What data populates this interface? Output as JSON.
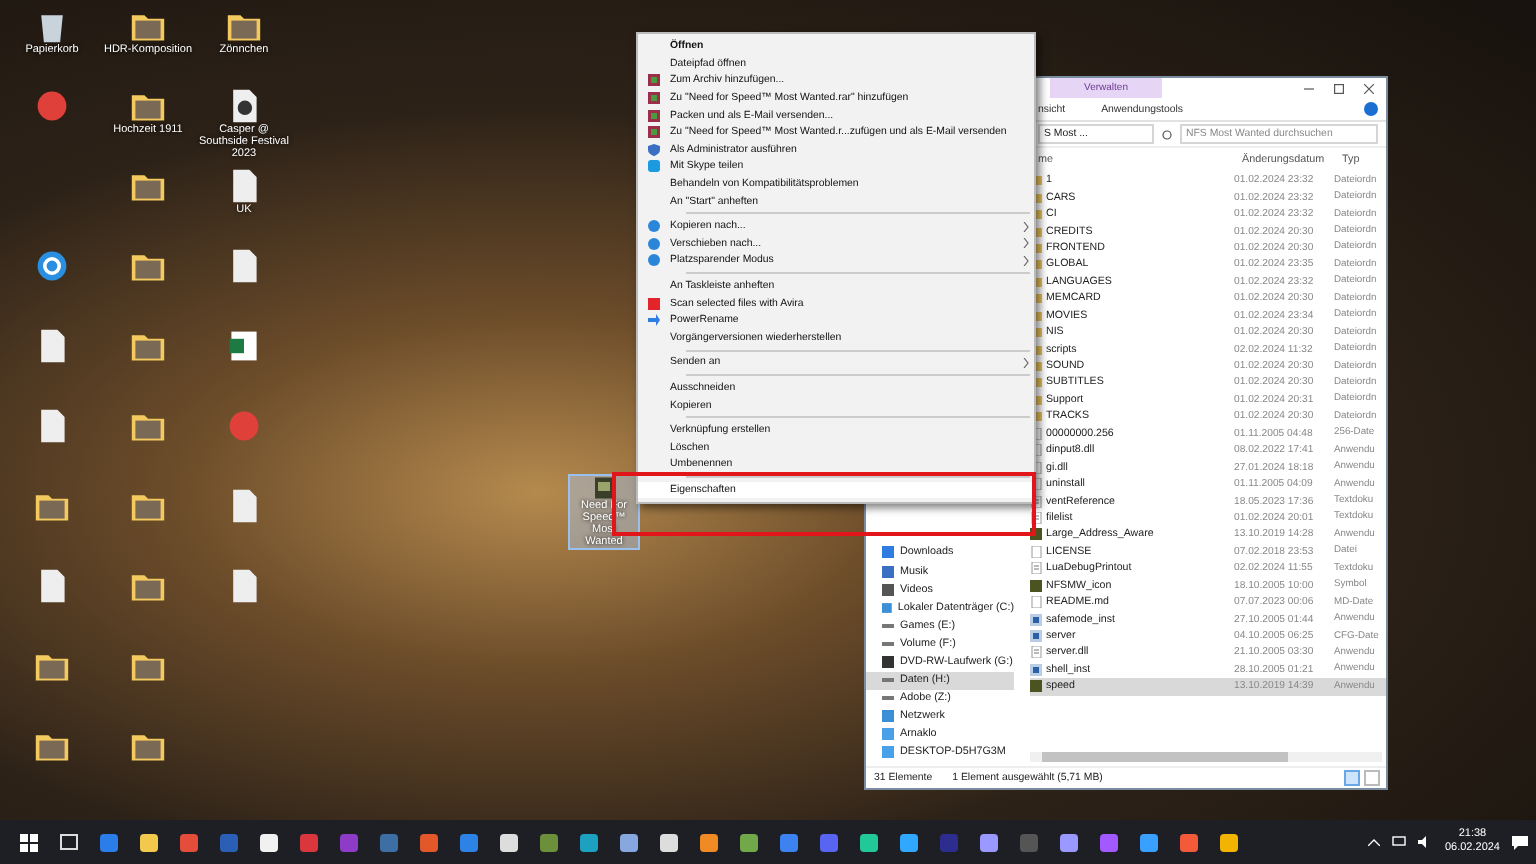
{
  "desktop": {
    "columns": [
      [
        {
          "kind": "recycle",
          "label": "Papierkorb"
        },
        {
          "kind": "app"
        },
        {
          "kind": "gap"
        },
        {
          "kind": "sync"
        },
        {
          "kind": "file"
        },
        {
          "kind": "file"
        },
        {
          "kind": "folder"
        },
        {
          "kind": "file"
        },
        {
          "kind": "folder"
        },
        {
          "kind": "folder"
        }
      ],
      [
        {
          "kind": "folder",
          "label": "HDR-Komposition"
        },
        {
          "kind": "folder",
          "label": "Hochzeit 1911"
        },
        {
          "kind": "folder"
        },
        {
          "kind": "folder"
        },
        {
          "kind": "folder"
        },
        {
          "kind": "folder"
        },
        {
          "kind": "folder"
        },
        {
          "kind": "folder"
        },
        {
          "kind": "folder"
        },
        {
          "kind": "folder"
        }
      ],
      [
        {
          "kind": "folder",
          "label": "Zönnchen"
        },
        {
          "kind": "media",
          "label": "Casper @ Southside Festival 2023"
        },
        {
          "kind": "file",
          "label": "UK"
        },
        {
          "kind": "file"
        },
        {
          "kind": "sheet"
        },
        {
          "kind": "app"
        },
        {
          "kind": "file"
        },
        {
          "kind": "file"
        }
      ]
    ],
    "selected_icon": {
      "label": "Need For Speed™ Most Wanted",
      "selected": true
    }
  },
  "context_menu": {
    "groups": [
      [
        {
          "label": "Öffnen",
          "bold": true,
          "kind": "plain",
          "submenu": false,
          "selected": false
        },
        {
          "label": "Dateipfad öffnen",
          "bold": false,
          "kind": "plain",
          "submenu": false,
          "selected": false
        },
        {
          "label": "Zum Archiv hinzufügen...",
          "bold": false,
          "kind": "archive",
          "submenu": false,
          "selected": false
        },
        {
          "label": "Zu \"Need for Speed™ Most Wanted.rar\" hinzufügen",
          "bold": false,
          "kind": "archive",
          "submenu": false,
          "selected": false
        },
        {
          "label": "Packen und als E-Mail versenden...",
          "bold": false,
          "kind": "archive",
          "submenu": false,
          "selected": false
        },
        {
          "label": "Zu \"Need for Speed™ Most Wanted.r...zufügen und als E-Mail versenden",
          "bold": false,
          "kind": "archive",
          "submenu": false,
          "selected": false
        },
        {
          "label": "Als Administrator ausführen",
          "bold": false,
          "kind": "admin",
          "submenu": false,
          "selected": false
        },
        {
          "label": "Mit Skype teilen",
          "bold": false,
          "kind": "share",
          "submenu": false,
          "selected": false
        },
        {
          "label": "Behandeln von Kompatibilitätsproblemen",
          "bold": false,
          "kind": "plain",
          "submenu": false,
          "selected": false
        },
        {
          "label": "An \"Start\" anheften",
          "bold": false,
          "kind": "plain",
          "submenu": false,
          "selected": false
        }
      ],
      [
        {
          "label": "Kopieren nach...",
          "bold": false,
          "kind": "tool",
          "submenu": true,
          "selected": false
        },
        {
          "label": "Verschieben nach...",
          "bold": false,
          "kind": "tool",
          "submenu": true,
          "selected": false
        },
        {
          "label": "Platzsparender Modus",
          "bold": false,
          "kind": "tool",
          "submenu": true,
          "selected": false
        }
      ],
      [
        {
          "label": "An Taskleiste anheften",
          "bold": false,
          "kind": "plain",
          "submenu": false,
          "selected": false
        },
        {
          "label": "Scan selected files with Avira",
          "bold": false,
          "kind": "scan",
          "submenu": false,
          "selected": false
        },
        {
          "label": "PowerRename",
          "bold": false,
          "kind": "rename",
          "submenu": false,
          "selected": false
        },
        {
          "label": "Vorgängerversionen wiederherstellen",
          "bold": false,
          "kind": "plain",
          "submenu": false,
          "selected": false
        }
      ],
      [
        {
          "label": "Senden an",
          "bold": false,
          "kind": "plain",
          "submenu": true,
          "selected": false
        }
      ],
      [
        {
          "label": "Ausschneiden",
          "bold": false,
          "kind": "plain",
          "submenu": false,
          "selected": false
        },
        {
          "label": "Kopieren",
          "bold": false,
          "kind": "plain",
          "submenu": false,
          "selected": false
        }
      ],
      [
        {
          "label": "Verknüpfung erstellen",
          "bold": false,
          "kind": "plain",
          "submenu": false,
          "selected": false
        },
        {
          "label": "Löschen",
          "bold": false,
          "kind": "plain",
          "submenu": false,
          "selected": false
        },
        {
          "label": "Umbenennen",
          "bold": false,
          "kind": "plain",
          "submenu": false,
          "selected": false
        }
      ],
      [
        {
          "label": "Eigenschaften",
          "bold": false,
          "kind": "plain",
          "submenu": false,
          "selected": true
        }
      ]
    ]
  },
  "explorer": {
    "ribbon_context_tab": "Verwalten",
    "ribbon_tabs": [
      "nsicht",
      "Anwendungstools"
    ],
    "address": "S Most ...",
    "search": {
      "placeholder": "NFS Most Wanted durchsuchen"
    },
    "columns": [
      "me",
      "Änderungsdatum",
      "Typ"
    ],
    "files": [
      {
        "kind": "folder",
        "name": "1",
        "date": "01.02.2024 23:32",
        "type": "Dateiordn",
        "selected": false
      },
      {
        "kind": "folder",
        "name": "CARS",
        "date": "01.02.2024 23:32",
        "type": "Dateiordn",
        "selected": false
      },
      {
        "kind": "folder",
        "name": "CI",
        "date": "01.02.2024 23:32",
        "type": "Dateiordn",
        "selected": false
      },
      {
        "kind": "folder",
        "name": "CREDITS",
        "date": "01.02.2024 20:30",
        "type": "Dateiordn",
        "selected": false
      },
      {
        "kind": "folder",
        "name": "FRONTEND",
        "date": "01.02.2024 20:30",
        "type": "Dateiordn",
        "selected": false
      },
      {
        "kind": "folder",
        "name": "GLOBAL",
        "date": "01.02.2024 23:35",
        "type": "Dateiordn",
        "selected": false
      },
      {
        "kind": "folder",
        "name": "LANGUAGES",
        "date": "01.02.2024 23:32",
        "type": "Dateiordn",
        "selected": false
      },
      {
        "kind": "folder",
        "name": "MEMCARD",
        "date": "01.02.2024 20:30",
        "type": "Dateiordn",
        "selected": false
      },
      {
        "kind": "folder",
        "name": "MOVIES",
        "date": "01.02.2024 23:34",
        "type": "Dateiordn",
        "selected": false
      },
      {
        "kind": "folder",
        "name": "NIS",
        "date": "01.02.2024 20:30",
        "type": "Dateiordn",
        "selected": false
      },
      {
        "kind": "folder",
        "name": "scripts",
        "date": "02.02.2024 11:32",
        "type": "Dateiordn",
        "selected": false
      },
      {
        "kind": "folder",
        "name": "SOUND",
        "date": "01.02.2024 20:30",
        "type": "Dateiordn",
        "selected": false
      },
      {
        "kind": "folder",
        "name": "SUBTITLES",
        "date": "01.02.2024 20:30",
        "type": "Dateiordn",
        "selected": false
      },
      {
        "kind": "folder",
        "name": "Support",
        "date": "01.02.2024 20:31",
        "type": "Dateiordn",
        "selected": false
      },
      {
        "kind": "folder",
        "name": "TRACKS",
        "date": "01.02.2024 20:30",
        "type": "Dateiordn",
        "selected": false
      },
      {
        "kind": "file",
        "name": "00000000.256",
        "date": "01.11.2005 04:48",
        "type": "256-Date",
        "selected": false
      },
      {
        "kind": "file",
        "name": "dinput8.dll",
        "date": "08.02.2022 17:41",
        "type": "Anwendu",
        "selected": false
      },
      {
        "kind": "file",
        "name": "gi.dll",
        "date": "27.01.2024 18:18",
        "type": "Anwendu",
        "selected": false
      },
      {
        "kind": "file",
        "name": "uninstall",
        "date": "01.11.2005 04:09",
        "type": "Anwendu",
        "selected": false
      },
      {
        "kind": "text",
        "name": "ventReference",
        "date": "18.05.2023 17:36",
        "type": "Textdoku",
        "selected": false
      },
      {
        "kind": "text",
        "name": "filelist",
        "date": "01.02.2024 20:01",
        "type": "Textdoku",
        "selected": false
      },
      {
        "kind": "app",
        "name": "Large_Address_Aware",
        "date": "13.10.2019 14:28",
        "type": "Anwendu",
        "selected": false
      },
      {
        "kind": "file",
        "name": "LICENSE",
        "date": "07.02.2018 23:53",
        "type": "Datei",
        "selected": false
      },
      {
        "kind": "text",
        "name": "LuaDebugPrintout",
        "date": "02.02.2024 11:55",
        "type": "Textdoku",
        "selected": false
      },
      {
        "kind": "app",
        "name": "NFSMW_icon",
        "date": "18.10.2005 10:00",
        "type": "Symbol",
        "selected": false
      },
      {
        "kind": "file",
        "name": "README.md",
        "date": "07.07.2023 00:06",
        "type": "MD-Date",
        "selected": false
      },
      {
        "kind": "setup",
        "name": "safemode_inst",
        "date": "27.10.2005 01:44",
        "type": "Anwendu",
        "selected": false
      },
      {
        "kind": "setup",
        "name": "server",
        "date": "04.10.2005 06:25",
        "type": "CFG-Date",
        "selected": false
      },
      {
        "kind": "text",
        "name": "server.dll",
        "date": "21.10.2005 03:30",
        "type": "Anwendu",
        "selected": false
      },
      {
        "kind": "setup",
        "name": "shell_inst",
        "date": "28.10.2005 01:21",
        "type": "Anwendu",
        "selected": false
      },
      {
        "kind": "app",
        "name": "speed",
        "date": "13.10.2019 14:39",
        "type": "Anwendu",
        "selected": true
      }
    ],
    "nav": [
      {
        "label": "Downloads",
        "kind": "download",
        "selected": false
      },
      {
        "label": "Musik",
        "kind": "music",
        "selected": false
      },
      {
        "label": "Videos",
        "kind": "video",
        "selected": false
      },
      {
        "label": "Lokaler Datenträger (C:)",
        "kind": "system",
        "selected": false
      },
      {
        "label": "Games (E:)",
        "kind": "drive",
        "selected": false
      },
      {
        "label": "Volume (F:)",
        "kind": "drive",
        "selected": false
      },
      {
        "label": "DVD-RW-Laufwerk (G:)",
        "kind": "dvd",
        "selected": false
      },
      {
        "label": "Daten (H:)",
        "kind": "drive",
        "selected": true
      },
      {
        "label": "Adobe (Z:)",
        "kind": "drive",
        "selected": false
      },
      {
        "label": "Netzwerk",
        "kind": "network",
        "selected": false
      },
      {
        "label": "Arnaklo",
        "kind": "pc",
        "selected": false
      },
      {
        "label": "DESKTOP-D5H7G3M",
        "kind": "pc",
        "selected": false
      }
    ],
    "status": {
      "count": "31 Elemente",
      "selection": "1 Element ausgewählt (5,71 MB)"
    }
  },
  "taskbar": {
    "time": "21:38",
    "date": "06.02.2024"
  }
}
